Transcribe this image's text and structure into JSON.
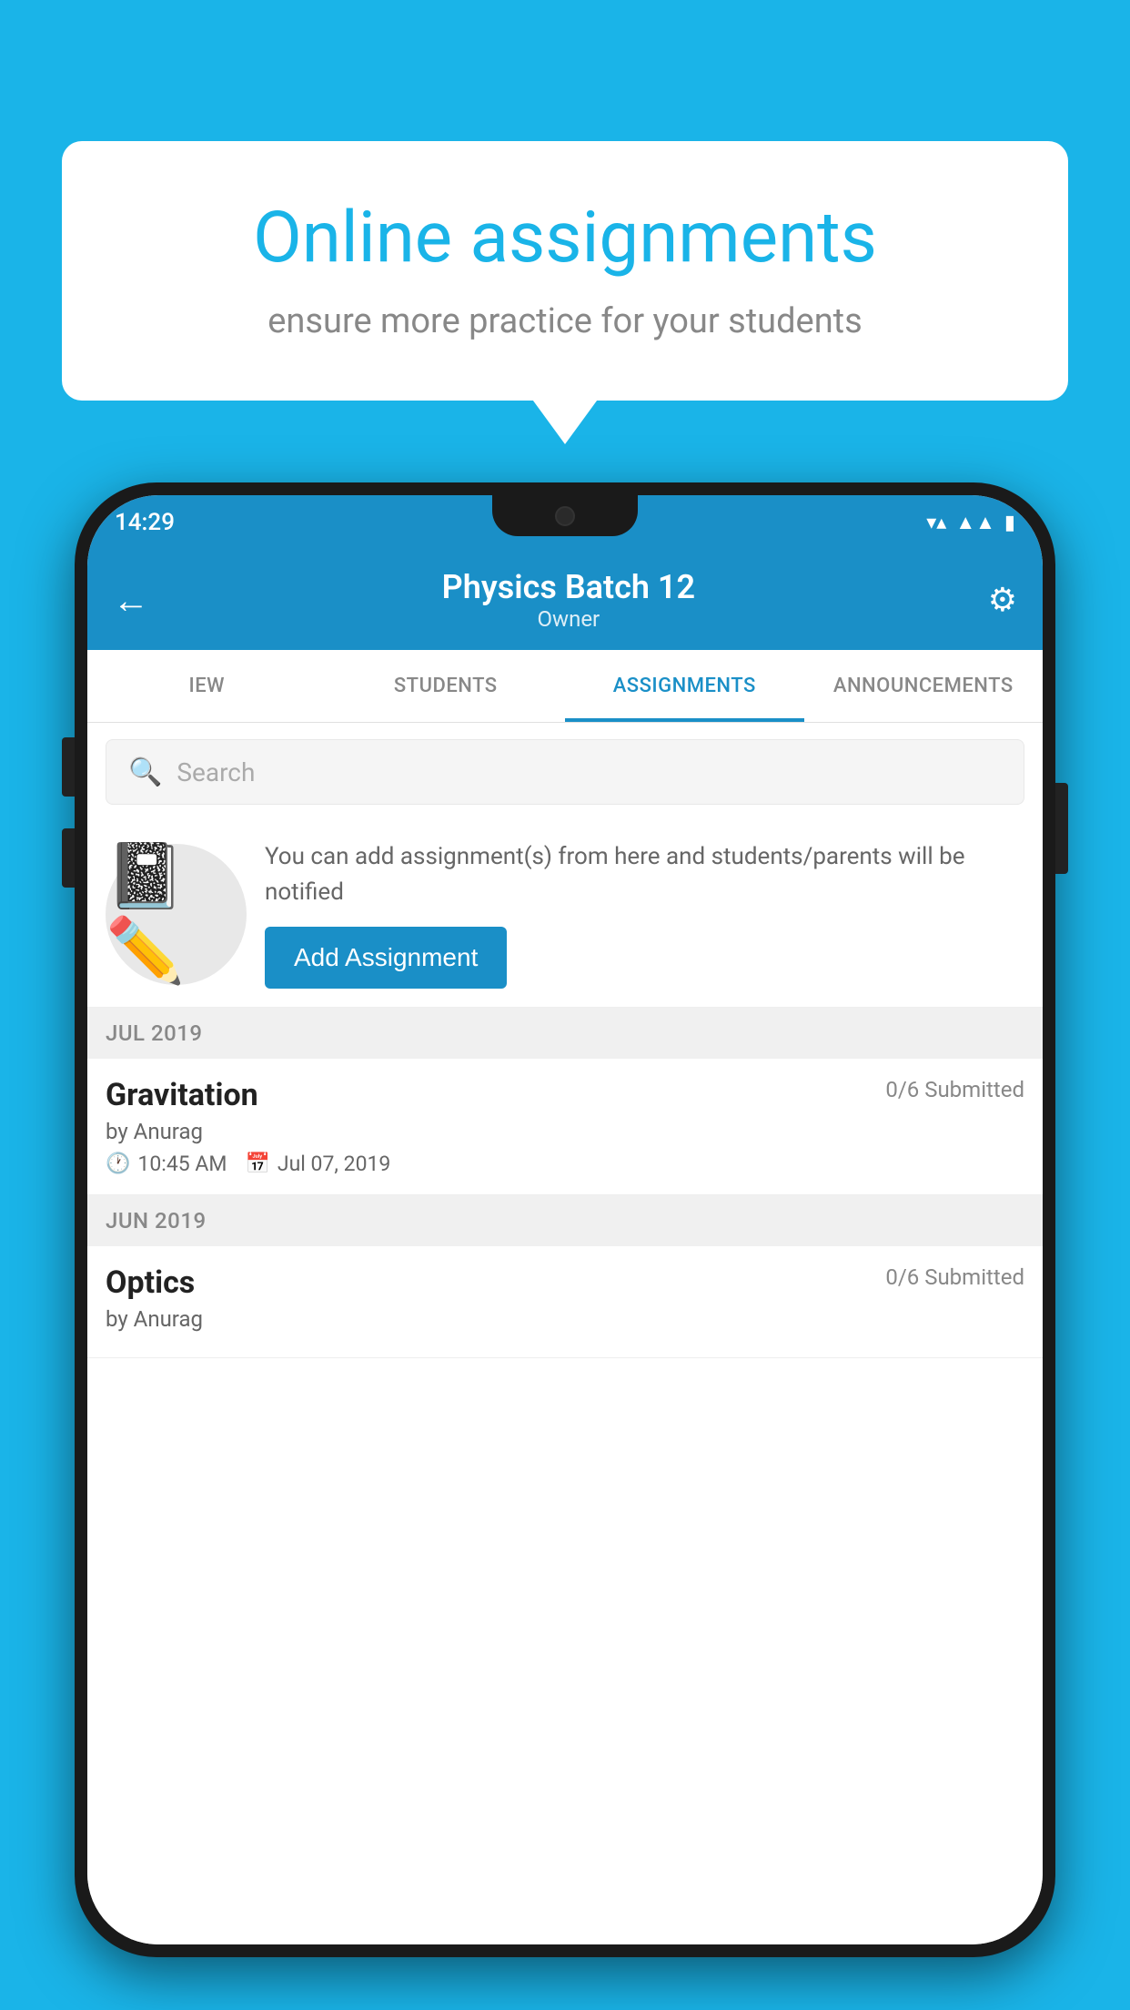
{
  "background_color": "#1ab4e8",
  "speech_bubble": {
    "title": "Online assignments",
    "subtitle": "ensure more practice for your students"
  },
  "status_bar": {
    "time": "14:29",
    "wifi": "▼",
    "signal": "▲",
    "battery": "▮"
  },
  "header": {
    "title": "Physics Batch 12",
    "subtitle": "Owner",
    "back_label": "←",
    "settings_label": "⚙"
  },
  "tabs": [
    {
      "id": "overview",
      "label": "IEW",
      "active": false
    },
    {
      "id": "students",
      "label": "STUDENTS",
      "active": false
    },
    {
      "id": "assignments",
      "label": "ASSIGNMENTS",
      "active": true
    },
    {
      "id": "announcements",
      "label": "ANNOUNCEMENTS",
      "active": false
    }
  ],
  "search": {
    "placeholder": "Search"
  },
  "promo": {
    "text": "You can add assignment(s) from here and students/parents will be notified",
    "button_label": "Add Assignment"
  },
  "sections": [
    {
      "header": "JUL 2019",
      "assignments": [
        {
          "name": "Gravitation",
          "submitted": "0/6 Submitted",
          "by": "by Anurag",
          "time": "10:45 AM",
          "date": "Jul 07, 2019"
        }
      ]
    },
    {
      "header": "JUN 2019",
      "assignments": [
        {
          "name": "Optics",
          "submitted": "0/6 Submitted",
          "by": "by Anurag",
          "time": "",
          "date": ""
        }
      ]
    }
  ]
}
